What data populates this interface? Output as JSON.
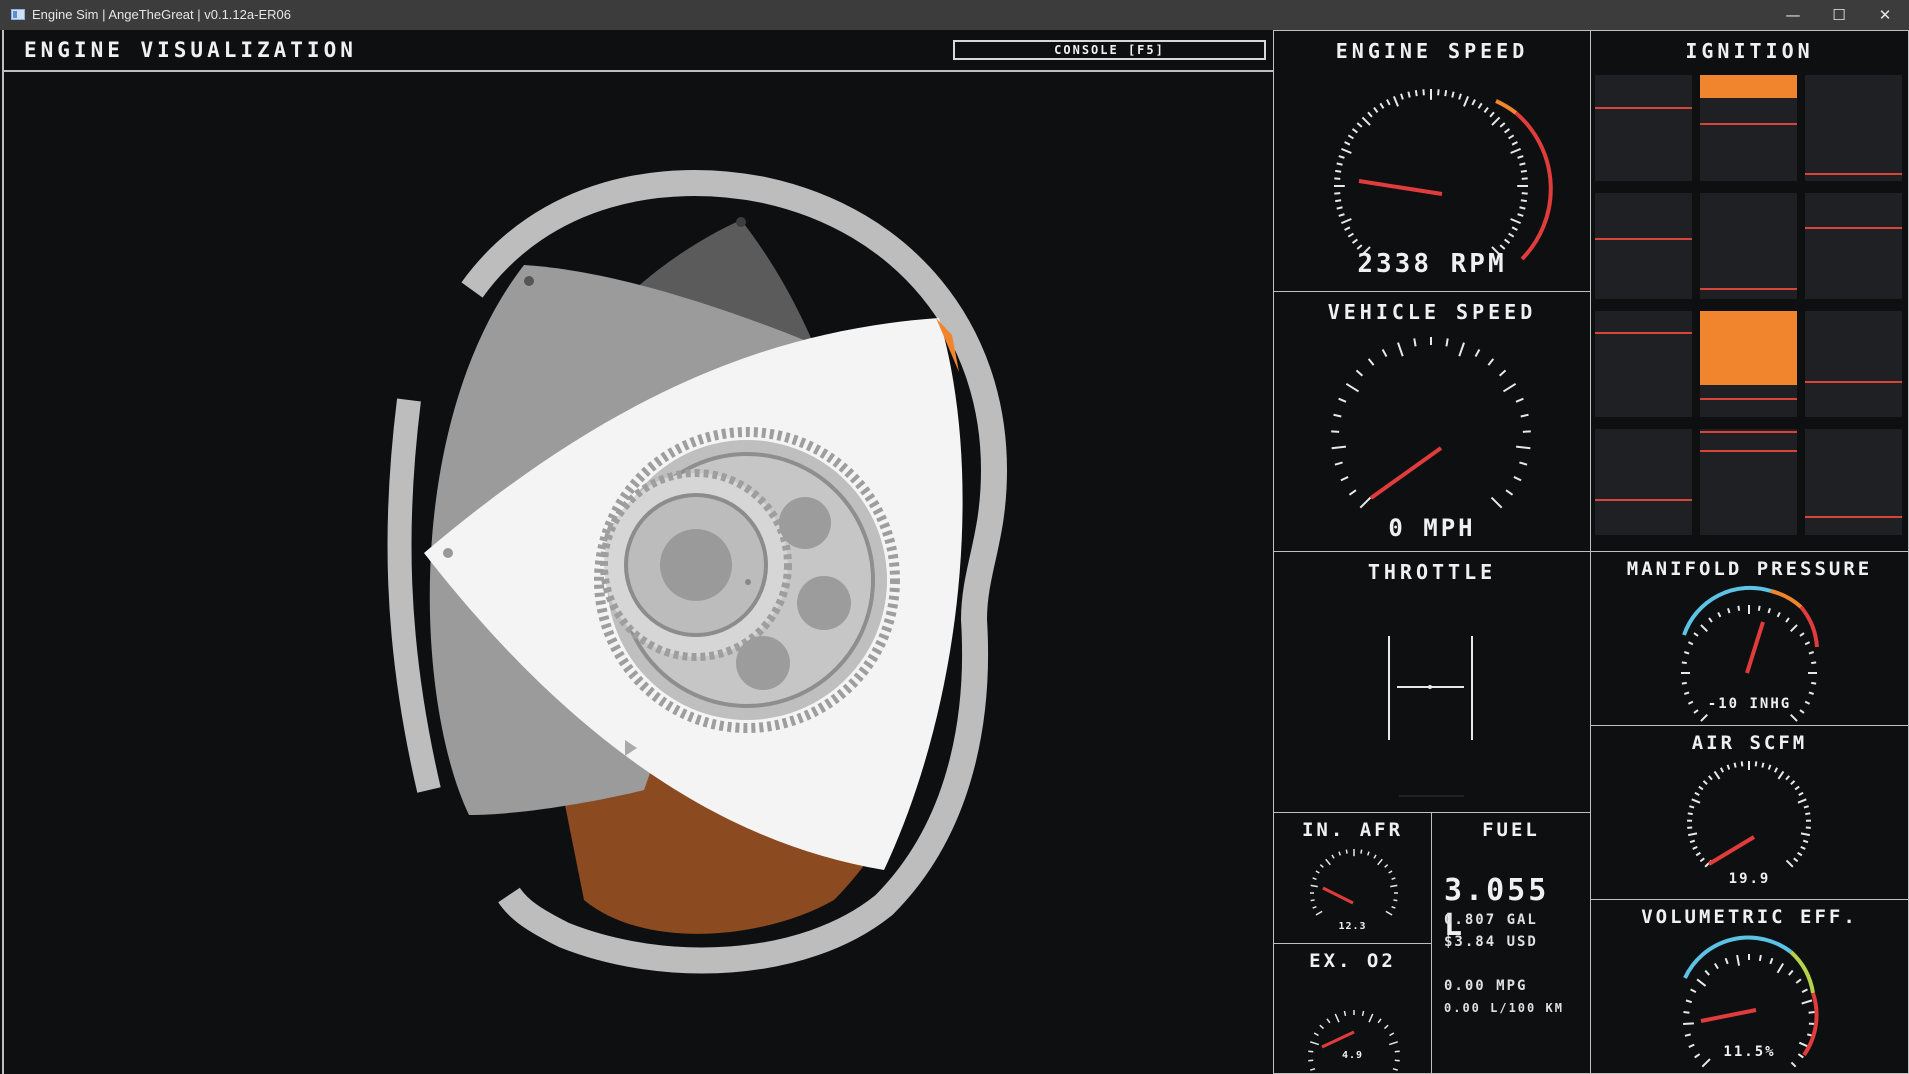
{
  "window": {
    "title": "Engine Sim | AngeTheGreat | v0.1.12a-ER06",
    "minimize": "—",
    "maximize": "☐",
    "close": "✕"
  },
  "visualization": {
    "title": "ENGINE VISUALIZATION",
    "console_label": "CONSOLE [F5]"
  },
  "engine_speed": {
    "title": "ENGINE SPEED",
    "readout": "2338 RPM"
  },
  "vehicle_speed": {
    "title": "VEHICLE SPEED",
    "readout": "0 MPH"
  },
  "ignition": {
    "title": "IGNITION",
    "cells": [
      {
        "fill": 0,
        "lines": [
          0.3
        ]
      },
      {
        "fill": 0.22,
        "lines": [
          0.45
        ]
      },
      {
        "fill": 0,
        "lines": [
          0.92
        ]
      },
      {
        "fill": 0,
        "lines": [
          0.42
        ]
      },
      {
        "fill": 0,
        "lines": [
          0.9
        ]
      },
      {
        "fill": 0,
        "lines": [
          0.32
        ]
      },
      {
        "fill": 0,
        "lines": [
          0.2
        ]
      },
      {
        "fill": 0.7,
        "lines": [
          0.82
        ]
      },
      {
        "fill": 0,
        "lines": [
          0.66
        ]
      },
      {
        "fill": 0,
        "lines": [
          0.66
        ]
      },
      {
        "fill": 0,
        "lines": [
          0.02,
          0.2
        ]
      },
      {
        "fill": 0,
        "lines": [
          0.82
        ]
      }
    ],
    "fill_color": "#f0852d",
    "line_color": "#d9443a"
  },
  "throttle": {
    "title": "THROTTLE"
  },
  "manifold_pressure": {
    "title": "MANIFOLD PRESSURE",
    "readout": "-10 INHG"
  },
  "air_scfm": {
    "title": "AIR SCFM",
    "readout": "19.9"
  },
  "volumetric_eff": {
    "title": "VOLUMETRIC EFF.",
    "readout": "11.5%"
  },
  "intake_afr": {
    "title": "IN. AFR",
    "readout": "12.3"
  },
  "exhaust_o2": {
    "title": "EX. O2",
    "readout": "4.9"
  },
  "fuel": {
    "title": "FUEL",
    "liters": "3.055 L",
    "gallons": "0.807 GAL",
    "cost": "$3.84 USD",
    "mpg": "0.00 MPG",
    "l_per_100km": "0.00 L/100 KM"
  },
  "colors": {
    "background": "#0e0f11",
    "needle": "#e03c3c",
    "accent_orange": "#f0852d",
    "accent_blue": "#5cc3e6",
    "rotor": "#f4f4f4",
    "housing": "#bdbdbd",
    "combustion": "#8b4a1f"
  }
}
